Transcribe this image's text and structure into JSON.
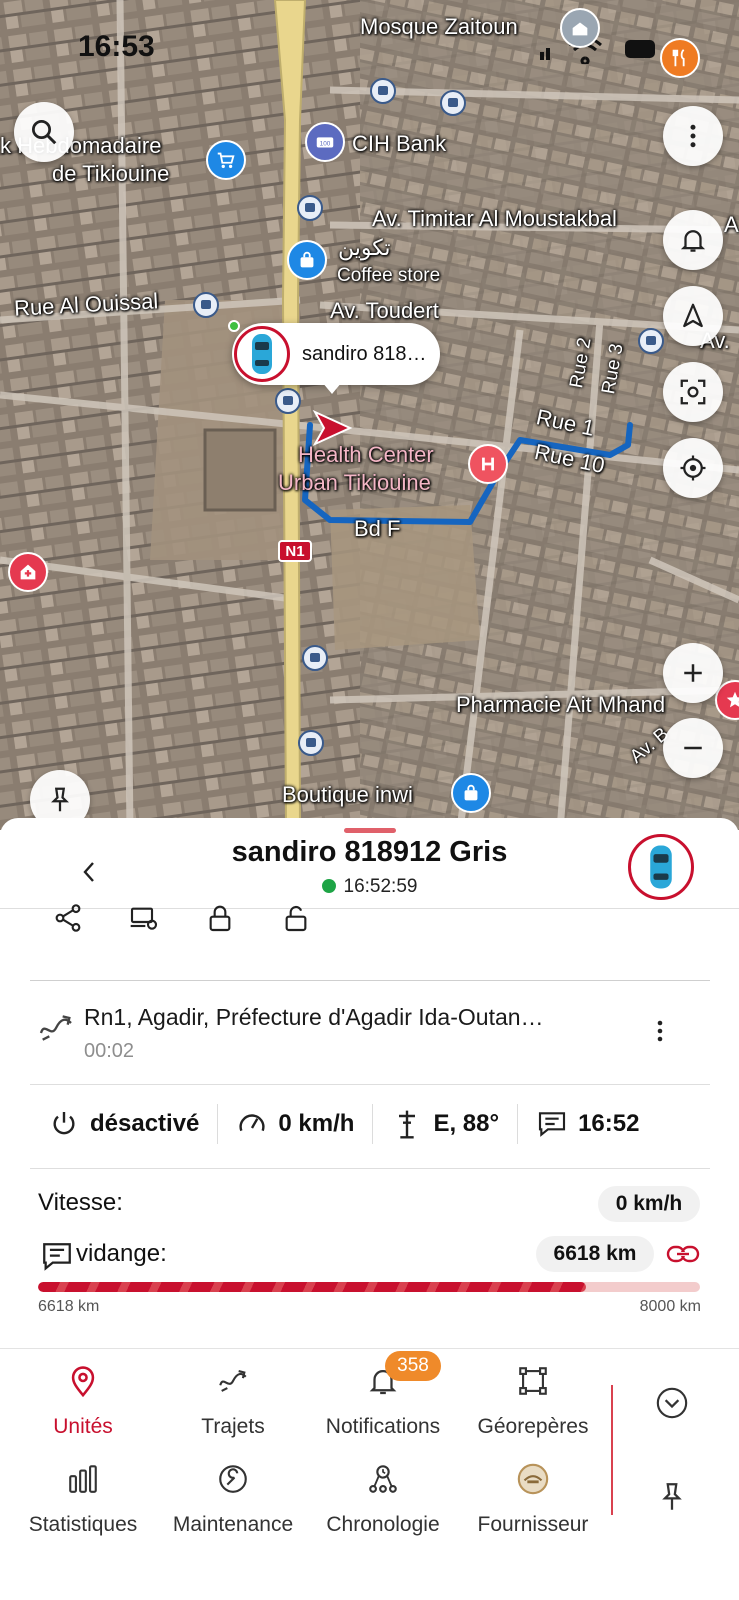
{
  "status_bar": {
    "time": "16:53"
  },
  "map": {
    "labels": {
      "mosque": "Mosque Zaitoun",
      "hebdo_1": "k Hebdomadaire",
      "hebdo_2": "de Tikiouine",
      "cih": "CIH Bank",
      "timitar": "Av. Timitar Al Moustakbal",
      "takwin": "تكوين",
      "coffee": "Coffee store",
      "ouissal": "Rue Al Ouissal",
      "toudert": "Av. Toudert",
      "av_right": "Av.",
      "rue2": "Rue 2",
      "rue3": "Rue 3",
      "rue1": "Rue 1",
      "rue10": "Rue 10",
      "health_1": "Health Center",
      "health_2": "Urban Tikiouine",
      "bdf": "Bd F",
      "n1": "N1",
      "pharmacie": "Pharmacie Ait Mhand",
      "av_b": "Av. B",
      "boutique": "Boutique inwi",
      "a_edge": "A"
    },
    "unit_bubble_name": "sandiro 818…",
    "colors": {
      "route": "#1565c0",
      "road": "#e9d68d",
      "accent": "#c8102e"
    }
  },
  "unit": {
    "title": "sandiro 818912 Gris",
    "last_update": "16:52:59",
    "online_color": "#1ea446"
  },
  "commands": [
    "share-icon",
    "device-settings-icon",
    "lock-icon",
    "unlock-icon"
  ],
  "location": {
    "address": "Rn1, Agadir, Préfecture d'Agadir Ida-Outan…",
    "duration": "00:02"
  },
  "stats": {
    "ignition": "désactivé",
    "speed": "0 km/h",
    "heading": "E, 88°",
    "message_time": "16:52"
  },
  "sensors": {
    "speed_label": "Vitesse:",
    "speed_value": "0 km/h",
    "oil_label": "vidange:",
    "oil_value": "6618 km",
    "progress_min": "6618 km",
    "progress_max": "8000 km",
    "progress_fraction": 0.8273
  },
  "nav": {
    "units": "Unités",
    "trips": "Trajets",
    "notifications": "Notifications",
    "notifications_badge": "358",
    "geofences": "Géorepères",
    "statistics": "Statistiques",
    "maintenance": "Maintenance",
    "timeline": "Chronologie",
    "provider": "Fournisseur"
  }
}
